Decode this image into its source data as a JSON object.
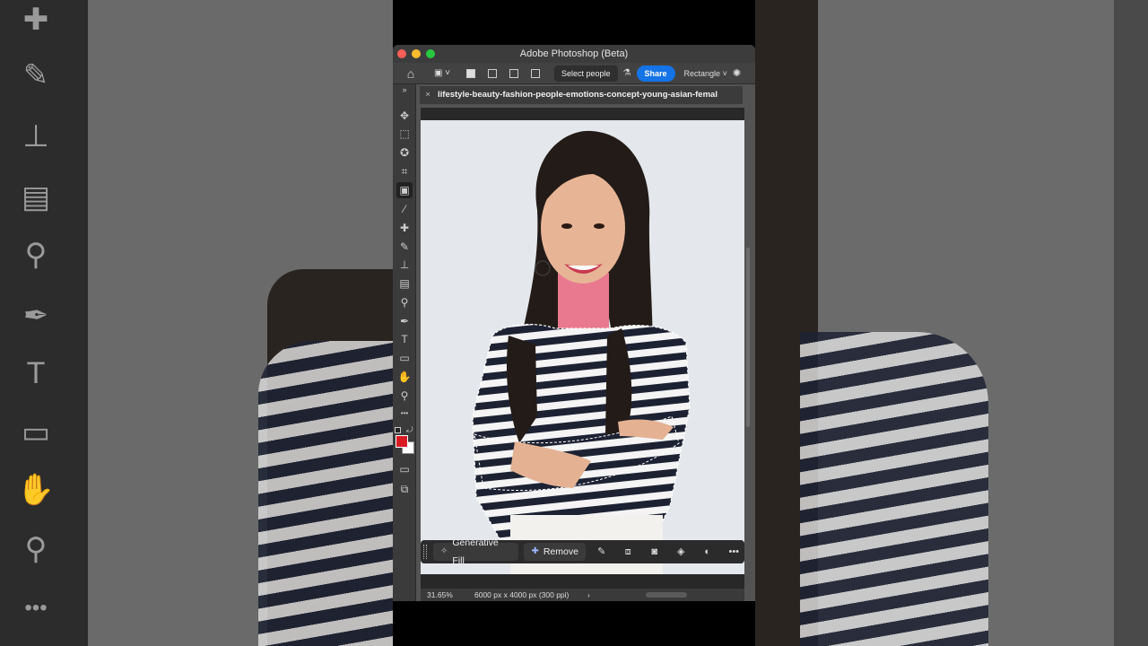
{
  "window": {
    "title": "Adobe Photoshop (Beta)",
    "traffic_colors": [
      "#ff5f57",
      "#febc2e",
      "#28c840"
    ]
  },
  "options_bar": {
    "home_icon": "home-icon",
    "select_people_label": "Select people",
    "share_label": "Share",
    "mode_label": "Rectangle"
  },
  "toolbar": {
    "collapse_glyph": "»",
    "tools": [
      {
        "name": "move-icon",
        "glyph": "✥"
      },
      {
        "name": "marquee-icon",
        "glyph": "⬚"
      },
      {
        "name": "quick-selection-icon",
        "glyph": "✪"
      },
      {
        "name": "crop-icon",
        "glyph": "⌗"
      },
      {
        "name": "object-selection-icon",
        "glyph": "▣"
      },
      {
        "name": "eyedropper-icon",
        "glyph": "⁄"
      },
      {
        "name": "healing-brush-icon",
        "glyph": "✚"
      },
      {
        "name": "brush-icon",
        "glyph": "✎"
      },
      {
        "name": "stamp-icon",
        "glyph": "⊥"
      },
      {
        "name": "gradient-icon",
        "glyph": "▤"
      },
      {
        "name": "dodge-icon",
        "glyph": "⚲"
      },
      {
        "name": "pen-icon",
        "glyph": "✒"
      },
      {
        "name": "type-icon",
        "glyph": "T"
      },
      {
        "name": "rectangle-icon",
        "glyph": "▭"
      },
      {
        "name": "hand-icon",
        "glyph": "✋"
      },
      {
        "name": "zoom-icon",
        "glyph": "⚲"
      },
      {
        "name": "more-tools-icon",
        "glyph": "•••"
      }
    ],
    "foreground_color": "#d81b23",
    "background_color": "#ffffff"
  },
  "document": {
    "tab_title": "lifestyle-beauty-fashion-people-emotions-concept-young-asian-femal",
    "close_glyph": "×"
  },
  "context_bar": {
    "generative_fill_label": "Generative Fill",
    "remove_label": "Remove",
    "icons": [
      "modify-selection-icon",
      "transform-icon",
      "mask-icon",
      "fill-icon",
      "adjust-icon",
      "more-icon"
    ]
  },
  "status": {
    "zoom": "31.65%",
    "doc_info": "6000 px x 4000 px (300 ppi)",
    "arrow": "›"
  },
  "colors": {
    "accent": "#1473e6",
    "neck_highlight": "#e8798f",
    "shirt_stripe_dark": "#1d2233"
  }
}
